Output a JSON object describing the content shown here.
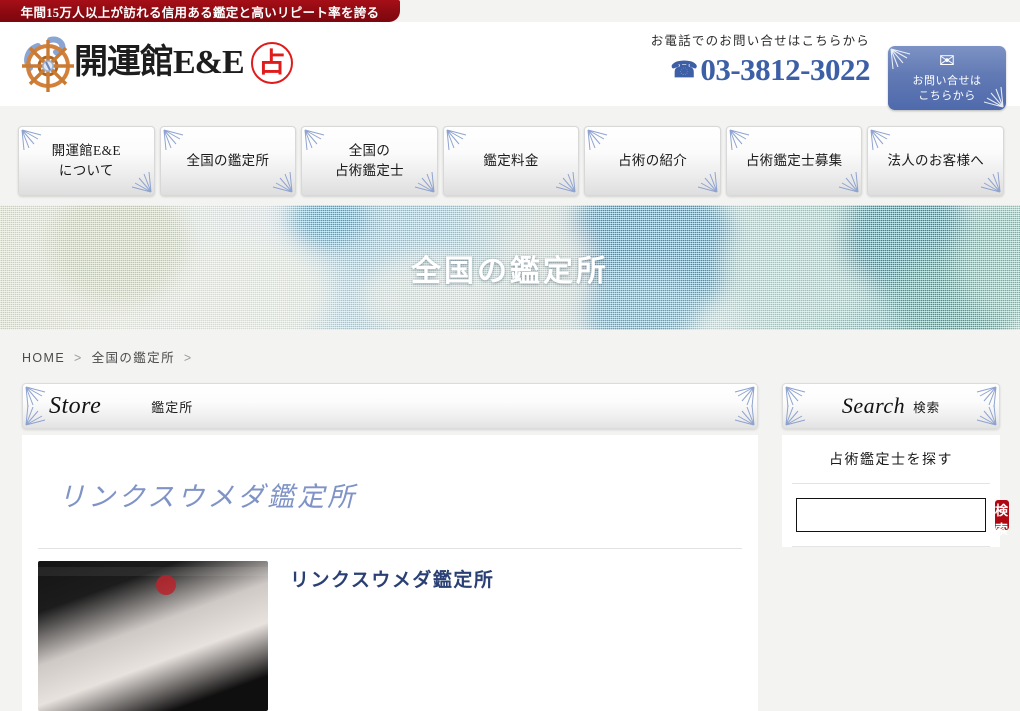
{
  "ribbon": {
    "text": "年間15万人以上が訪れる信用ある鑑定と高いリピート率を誇る"
  },
  "header": {
    "logo_text": "開運館E&E",
    "logo_seal": "占",
    "logo_icon": "ship-wheel-icon",
    "tel_label": "お電話でのお問い合せはこちらから",
    "tel_number": "03-3812-3022",
    "phone_icon": "☎",
    "contact_button": {
      "envelope_icon": "✉",
      "line1": "お問い合せは",
      "line2": "こちらから"
    }
  },
  "nav": {
    "items": [
      {
        "label": "開運館E&E\nについて"
      },
      {
        "label": "全国の鑑定所"
      },
      {
        "label": "全国の\n占術鑑定士"
      },
      {
        "label": "鑑定料金"
      },
      {
        "label": "占術の紹介"
      },
      {
        "label": "占術鑑定士募集"
      },
      {
        "label": "法人のお客様へ"
      }
    ]
  },
  "hero": {
    "title": "全国の鑑定所"
  },
  "breadcrumb": {
    "home": "HOME",
    "sep": ">",
    "current": "全国の鑑定所",
    "trailing_sep": ">"
  },
  "main": {
    "panel_title_en": "Store",
    "panel_title_jp": "鑑定所",
    "store_name": "リンクスウメダ鑑定所",
    "listing_title": "リンクスウメダ鑑定所",
    "thumbnail_icon": "store-photo"
  },
  "sidebar": {
    "panel_title_en": "Search",
    "panel_title_jp": "検索",
    "section_title": "占術鑑定士を探す",
    "search_value": "",
    "search_placeholder": "",
    "search_button": "検索"
  },
  "colors": {
    "ribbon_red": "#8d0a12",
    "accent_blue": "#3d5fa6",
    "button_red": "#b00812",
    "seal_red": "#e01b1b",
    "store_name_blue": "#7f93c6"
  }
}
